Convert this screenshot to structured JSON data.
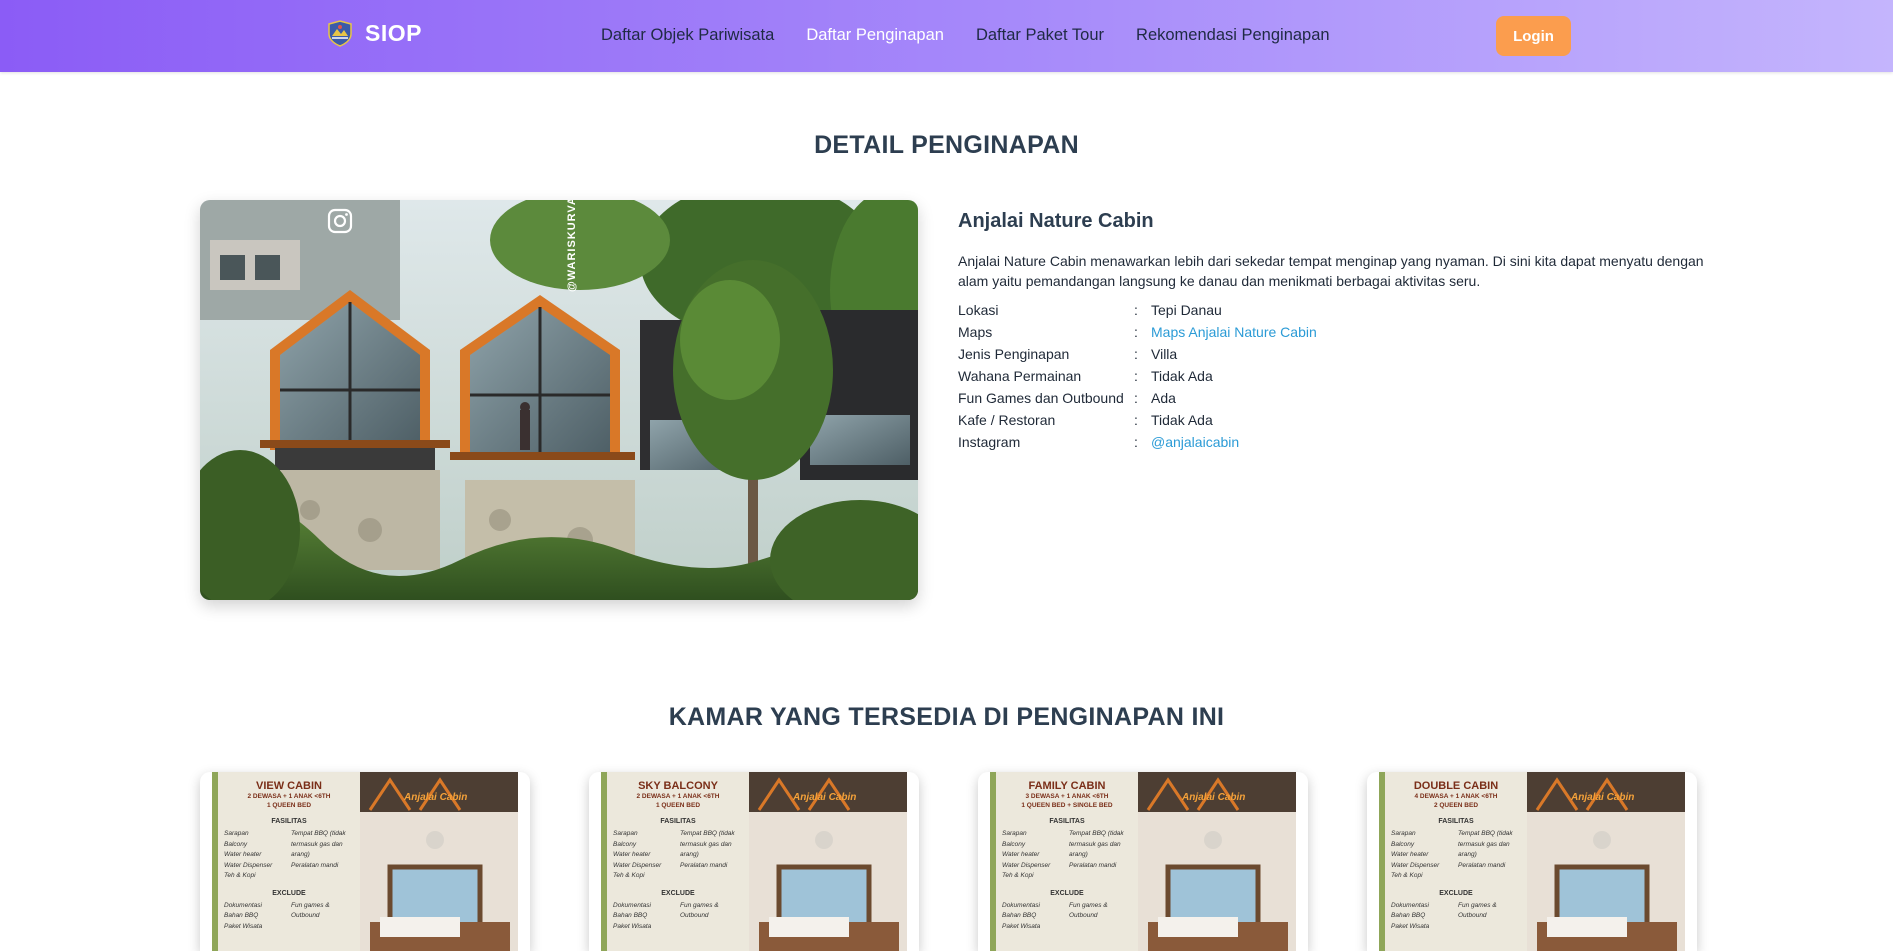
{
  "navbar": {
    "brand": "SIOP",
    "links": [
      {
        "label": "Daftar Objek Pariwisata",
        "active": false
      },
      {
        "label": "Daftar Penginapan",
        "active": true
      },
      {
        "label": "Daftar Paket Tour",
        "active": false
      },
      {
        "label": "Rekomendasi Penginapan",
        "active": false
      }
    ],
    "login_label": "Login"
  },
  "page_title": "DETAIL PENGINAPAN",
  "hero": {
    "photo_credit": "@WARISKURVAN"
  },
  "detail": {
    "name": "Anjalai Nature Cabin",
    "description": "Anjalai Nature Cabin menawarkan lebih dari sekedar tempat menginap yang nyaman. Di sini kita dapat menyatu dengan alam yaitu pemandangan langsung ke danau dan menikmati berbagai aktivitas seru.",
    "rows": [
      {
        "label": "Lokasi",
        "sep": ":",
        "value": "Tepi Danau",
        "link": false
      },
      {
        "label": "Maps",
        "sep": ":",
        "value": "Maps Anjalai Nature Cabin",
        "link": true
      },
      {
        "label": "Jenis Penginapan",
        "sep": ":",
        "value": "Villa",
        "link": false
      },
      {
        "label": "Wahana Permainan",
        "sep": ":",
        "value": "Tidak Ada",
        "link": false
      },
      {
        "label": "Fun Games dan Outbound",
        "sep": ":",
        "value": "Ada",
        "link": false
      },
      {
        "label": "Kafe / Restoran",
        "sep": ":",
        "value": "Tidak Ada",
        "link": false
      },
      {
        "label": "Instagram",
        "sep": ":",
        "value": "@anjalaicabin",
        "link": true
      }
    ]
  },
  "rooms_title": "KAMAR YANG TERSEDIA DI PENGINAPAN INI",
  "rooms": [
    {
      "title": "VIEW CABIN",
      "guests": "2 DEWASA + 1 ANAK <6TH",
      "bed": "1 QUEEN BED"
    },
    {
      "title": "SKY BALCONY",
      "guests": "2 DEWASA + 1 ANAK <6TH",
      "bed": "1 QUEEN BED"
    },
    {
      "title": "FAMILY CABIN",
      "guests": "3 DEWASA + 1 ANAK <6TH",
      "bed": "1 QUEEN BED + SINGLE BED"
    },
    {
      "title": "DOUBLE CABIN",
      "guests": "4 DEWASA + 1 ANAK <6TH",
      "bed": "2 QUEEN BED"
    }
  ],
  "flyer": {
    "brand": "Anjalai Cabin",
    "fasilitas_head": "FASILITAS",
    "fasilitas_left": [
      "Sarapan",
      "Balcony",
      "Water heater",
      "Water Dispenser",
      "Teh & Kopi"
    ],
    "fasilitas_right": [
      "Tempat BBQ (tidak termasuk gas dan arang)",
      "Peralatan mandi"
    ],
    "exclude_head": "EXCLUDE",
    "exclude_left": [
      "Dokumentasi",
      "Bahan BBQ",
      "Paket Wisata"
    ],
    "exclude_right": [
      "Fun games & Outbound"
    ]
  },
  "colors": {
    "nav_gradient_start": "#8b5cf6",
    "nav_gradient_end": "#c4b5fd",
    "login_button": "#fb9d4e",
    "title_text": "#2d3e50",
    "link": "#2b9bd6"
  }
}
